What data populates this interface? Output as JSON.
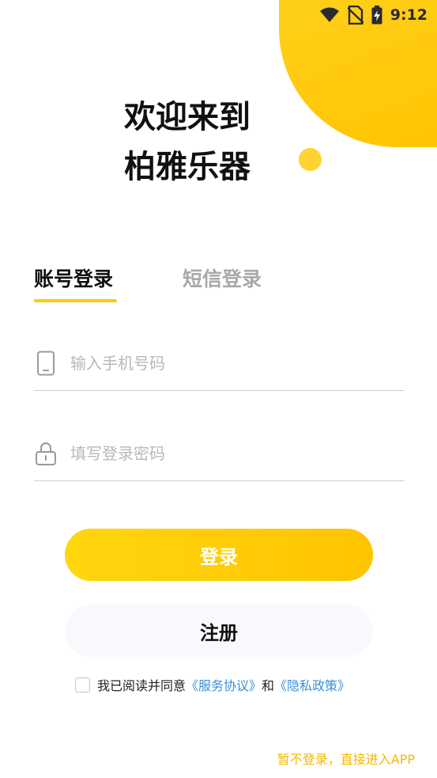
{
  "status_bar": {
    "time": "9:12",
    "icons": [
      "wifi-icon",
      "no-sim-icon",
      "battery-charging-icon"
    ]
  },
  "welcome": {
    "line1": "欢迎来到",
    "line2": "柏雅乐器"
  },
  "tabs": [
    {
      "label": "账号登录",
      "active": true
    },
    {
      "label": "短信登录",
      "active": false
    }
  ],
  "phone_field": {
    "icon": "phone-icon",
    "value": "",
    "placeholder": "输入手机号码"
  },
  "password_field": {
    "icon": "lock-icon",
    "value": "",
    "placeholder": "填写登录密码"
  },
  "buttons": {
    "login": "登录",
    "register": "注册"
  },
  "agreement": {
    "checked": false,
    "prefix": "我已阅读并同意",
    "service_link": "《服务协议》",
    "and": "和",
    "privacy_link": "《隐私政策》"
  },
  "skip_login": "暂不登录，直接进入APP",
  "colors": {
    "accent": "#FFC90D",
    "link": "#3a8fd6",
    "skip": "#F5B800"
  }
}
